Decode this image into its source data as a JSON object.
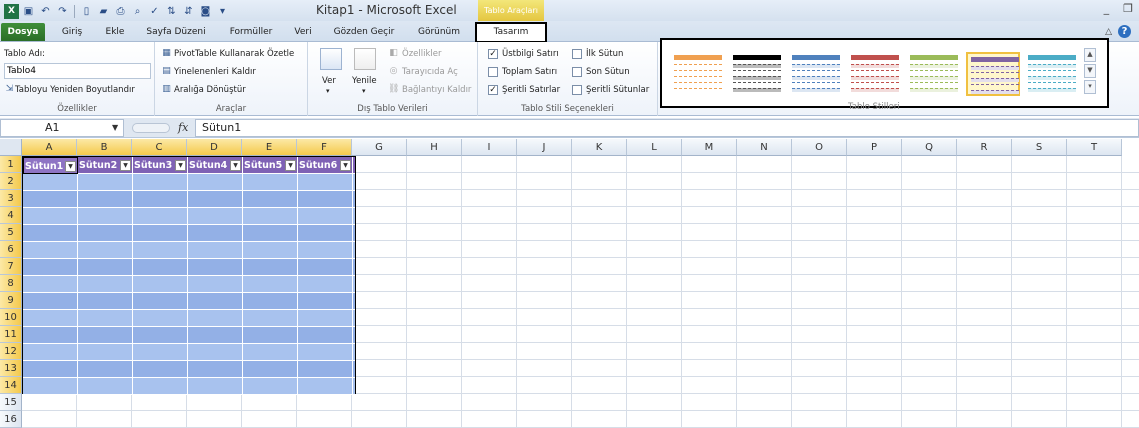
{
  "window": {
    "title": "Kitap1  -  Microsoft Excel",
    "context_tab_header": "Tablo Araçları",
    "controls": [
      "_",
      "❐"
    ]
  },
  "tabs": [
    {
      "label": "Dosya",
      "id": "file"
    },
    {
      "label": "Giriş",
      "id": "home"
    },
    {
      "label": "Ekle",
      "id": "insert"
    },
    {
      "label": "Sayfa Düzeni",
      "id": "page-layout"
    },
    {
      "label": "Formüller",
      "id": "formulas"
    },
    {
      "label": "Veri",
      "id": "data"
    },
    {
      "label": "Gözden Geçir",
      "id": "review"
    },
    {
      "label": "Görünüm",
      "id": "view"
    },
    {
      "label": "Tasarım",
      "id": "design"
    }
  ],
  "ribbon": {
    "properties": {
      "name_label": "Tablo Adı:",
      "name_value": "Tablo4",
      "resize_label": "Tabloyu Yeniden Boyutlandır",
      "group_label": "Özellikler"
    },
    "tools": {
      "pivot_label": "PivotTable Kullanarak Özetle",
      "remove_dup_label": "Yinelenenleri Kaldır",
      "convert_label": "Aralığa Dönüştür",
      "group_label": "Araçlar"
    },
    "external": {
      "export_label": "Ver",
      "refresh_label": "Yenile",
      "properties_label": "Özellikler",
      "browser_label": "Tarayıcıda Aç",
      "unlink_label": "Bağlantıyı Kaldır",
      "group_label": "Dış Tablo Verileri"
    },
    "style_options": {
      "header_row": {
        "label": "Üstbilgi Satırı",
        "checked": true
      },
      "total_row": {
        "label": "Toplam Satırı",
        "checked": false
      },
      "banded_rows": {
        "label": "Şeritli Satırlar",
        "checked": true
      },
      "first_column": {
        "label": "İlk Sütun",
        "checked": false
      },
      "last_column": {
        "label": "Son Sütun",
        "checked": false
      },
      "banded_columns": {
        "label": "Şeritli Sütunlar",
        "checked": false
      },
      "group_label": "Tablo Stili Seçenekleri"
    },
    "styles": {
      "group_label": "Tablo Stilleri",
      "swatches": [
        {
          "header": "#f0a050",
          "line": "#f0a050",
          "fill": "#ffffff"
        },
        {
          "header": "#000000",
          "line": "#555555",
          "fill": "#bbbbbb"
        },
        {
          "header": "#4f81bd",
          "line": "#4f81bd",
          "fill": "#dce6f2"
        },
        {
          "header": "#c0504d",
          "line": "#c0504d",
          "fill": "#f2dcdb"
        },
        {
          "header": "#9bbb59",
          "line": "#9bbb59",
          "fill": "#ebf1de"
        },
        {
          "header": "#8064a2",
          "line": "#8064a2",
          "fill": "#e4dfec"
        },
        {
          "header": "#4bacc6",
          "line": "#4bacc6",
          "fill": "#daeef3"
        }
      ],
      "selected_index": 5
    }
  },
  "formula_bar": {
    "name_box": "A1",
    "fx": "fx",
    "value": "Sütun1"
  },
  "grid": {
    "columns": [
      "A",
      "B",
      "C",
      "D",
      "E",
      "F",
      "G",
      "H",
      "I",
      "J",
      "K",
      "L",
      "M",
      "N",
      "O",
      "P",
      "Q",
      "R",
      "S",
      "T"
    ],
    "rows": [
      "1",
      "2",
      "3",
      "4",
      "5",
      "6",
      "7",
      "8",
      "9",
      "10",
      "11",
      "12",
      "13",
      "14",
      "15",
      "16"
    ],
    "table_headers": [
      "Sütun1",
      "Sütun2",
      "Sütun3",
      "Sütun4",
      "Sütun5",
      "Sütun6"
    ],
    "active_cell": "A1"
  },
  "colors": {
    "table_header": "#7f62b5",
    "band_light": "#a8c2ee",
    "band_dark": "#93b0e6",
    "file_tab": "#2f7a2c",
    "context_header": "#e8d050"
  }
}
